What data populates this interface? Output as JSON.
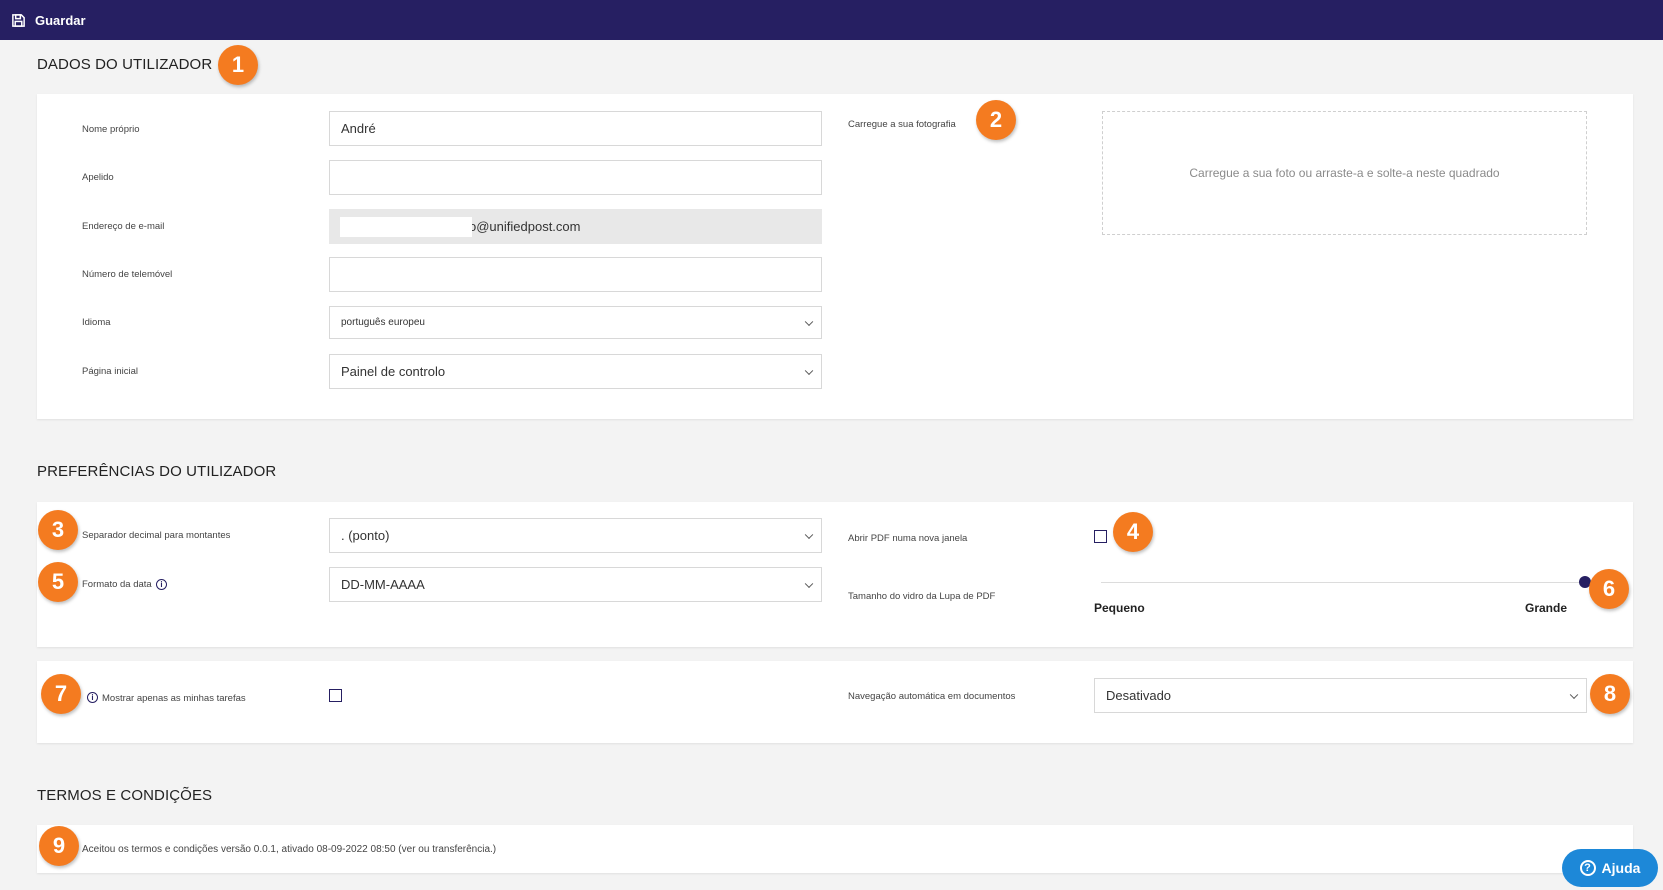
{
  "toolbar": {
    "save_label": "Guardar"
  },
  "user_data": {
    "title": "DADOS DO UTILIZADOR",
    "first_name_label": "Nome próprio",
    "first_name_value": "André",
    "surname_label": "Apelido",
    "surname_value": "",
    "email_label": "Endereço de e-mail",
    "email_value": "o@unifiedpost.com",
    "mobile_label": "Número de telemóvel",
    "mobile_value": "",
    "language_label": "Idioma",
    "language_value": "português europeu",
    "homepage_label": "Página inicial",
    "homepage_value": "Painel de controlo",
    "photo_label": "Carregue a sua fotografia",
    "dropzone_text": "Carregue a sua foto ou arraste-a e solte-a neste quadrado"
  },
  "preferences": {
    "title": "PREFERÊNCIAS DO UTILIZADOR",
    "decimal_label": "Separador decimal para montantes",
    "decimal_value": ". (ponto)",
    "date_format_label": "Formato da data",
    "date_format_value": "DD-MM-AAAA",
    "open_pdf_label": "Abrir PDF numa nova janela",
    "open_pdf_checked": false,
    "magnifier_label": "Tamanho do vidro da Lupa de PDF",
    "magnifier_min_label": "Pequeno",
    "magnifier_max_label": "Grande",
    "magnifier_level": 1.0,
    "my_tasks_label": "Mostrar apenas as minhas tarefas",
    "my_tasks_checked": false,
    "auto_nav_label": "Navegação automática em documentos",
    "auto_nav_value": "Desativado"
  },
  "terms": {
    "title": "TERMOS E CONDIÇÕES",
    "text": "Aceitou os termos e condições versão 0.0.1, ativado 08-09-2022 08:50 (ver ou transferência.)"
  },
  "badges": [
    "1",
    "2",
    "3",
    "4",
    "5",
    "6",
    "7",
    "8",
    "9"
  ],
  "help": {
    "label": "Ajuda"
  },
  "icons": {
    "save": "save-icon",
    "info": "info-icon",
    "help": "help-icon",
    "chevron": "chevron-down-icon"
  },
  "colors": {
    "topbar": "#261f62",
    "badge": "#f47b20",
    "help": "#1d88d8"
  }
}
